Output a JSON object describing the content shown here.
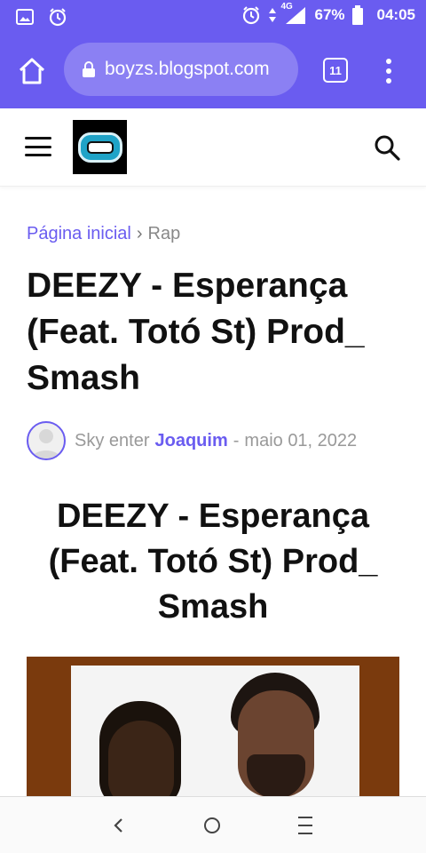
{
  "status_bar": {
    "battery": "67%",
    "time": "04:05",
    "network": "4G"
  },
  "browser": {
    "url": "boyzs.blogspot.com",
    "tab_count": "11"
  },
  "breadcrumb": {
    "home": "Página inicial",
    "separator": "›",
    "category": "Rap"
  },
  "post": {
    "title": "DEEZY - Esperança (Feat. Totó St) Prod_ Smash",
    "author_prefix": "Sky enter",
    "author": "Joaquim",
    "date_separator": "-",
    "date": "maio 01, 2022",
    "heading": "DEEZY - Esperança (Feat. Totó St) Prod_ Smash"
  },
  "colors": {
    "accent": "#6a5cf0",
    "image_background": "#7a3a0d"
  }
}
